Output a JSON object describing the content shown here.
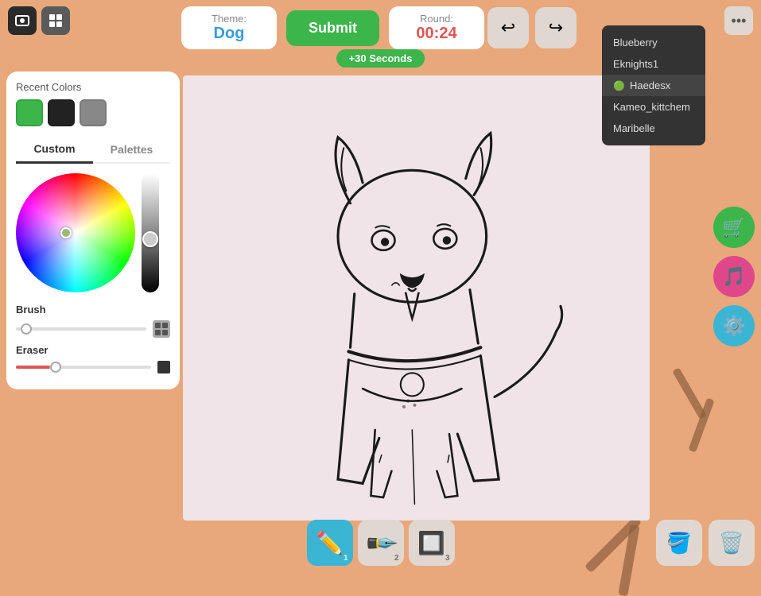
{
  "topBar": {
    "themeLabel": "Theme:",
    "themeValue": "Dog",
    "submitLabel": "Submit",
    "roundLabel": "Round:",
    "roundValue": "00:24",
    "plusSeconds": "+30 Seconds"
  },
  "toolbar": {
    "undoLabel": "↩",
    "redoLabel": "↪"
  },
  "recentColors": {
    "label": "Recent Colors",
    "colors": [
      "#3cb54a",
      "#222222",
      "#888888"
    ]
  },
  "tabs": {
    "customLabel": "Custom",
    "palettesLabel": "Palettes"
  },
  "tools": {
    "brushLabel": "Brush",
    "eraserLabel": "Eraser"
  },
  "bottomTools": [
    {
      "icon": "✏️",
      "num": "1",
      "active": true
    },
    {
      "icon": "🖊",
      "num": "2",
      "active": false
    },
    {
      "icon": "◻",
      "num": "3",
      "active": false
    }
  ],
  "players": [
    {
      "name": "Blueberry",
      "active": false
    },
    {
      "name": "Eknights1",
      "active": false
    },
    {
      "name": "Haedesx",
      "active": true
    },
    {
      "name": "Kameo_kittchem",
      "active": false
    },
    {
      "name": "Maribelle",
      "active": false
    }
  ],
  "rightButtons": [
    {
      "icon": "🛒",
      "color": "green"
    },
    {
      "icon": "🎵",
      "color": "pink"
    },
    {
      "icon": "⚙️",
      "color": "cyan"
    }
  ],
  "fillBtnIcon": "🪣",
  "trashBtnIcon": "🗑️",
  "moreIcon": "···"
}
